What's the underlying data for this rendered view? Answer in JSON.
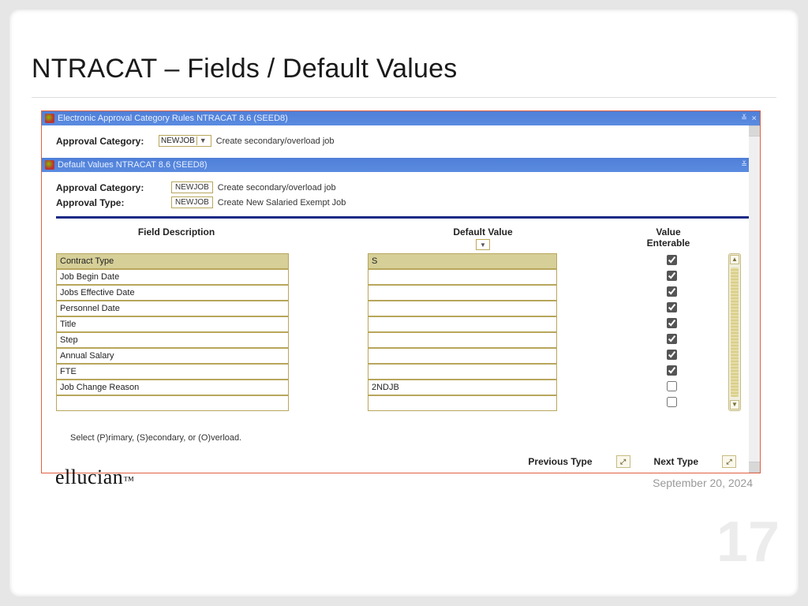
{
  "slide": {
    "title": "NTRACAT – Fields / Default Values",
    "number": "17",
    "date": "September 20, 2024",
    "brand": "ellucian",
    "brand_suffix": "™"
  },
  "window_main": {
    "title": "Electronic Approval Category Rules NTRACAT 8.6 (SEED8)"
  },
  "header": {
    "approval_category_label": "Approval Category:",
    "approval_category_code": "NEWJOB",
    "approval_category_desc": "Create secondary/overload job"
  },
  "window_sub": {
    "title": "Default Values NTRACAT 8.6 (SEED8)"
  },
  "subheader": {
    "approval_category_label": "Approval Category:",
    "approval_category_code": "NEWJOB",
    "approval_category_desc": "Create secondary/overload job",
    "approval_type_label": "Approval Type:",
    "approval_type_code": "NEWJOB",
    "approval_type_desc": "Create New Salaried Exempt Job"
  },
  "columns": {
    "field_description": "Field Description",
    "default_value": "Default Value",
    "value_enterable_1": "Value",
    "value_enterable_2": "Enterable"
  },
  "rows": [
    {
      "field": "Contract Type",
      "default": "S",
      "enterable": true,
      "selected": true
    },
    {
      "field": "Job Begin Date",
      "default": "",
      "enterable": true,
      "selected": false
    },
    {
      "field": "Jobs Effective Date",
      "default": "",
      "enterable": true,
      "selected": false
    },
    {
      "field": "Personnel Date",
      "default": "",
      "enterable": true,
      "selected": false
    },
    {
      "field": "Title",
      "default": "",
      "enterable": true,
      "selected": false
    },
    {
      "field": "Step",
      "default": "",
      "enterable": true,
      "selected": false
    },
    {
      "field": "Annual Salary",
      "default": "",
      "enterable": true,
      "selected": false
    },
    {
      "field": "FTE",
      "default": "",
      "enterable": true,
      "selected": false
    },
    {
      "field": "Job Change Reason",
      "default": "2NDJB",
      "enterable": false,
      "selected": false
    },
    {
      "field": "",
      "default": "",
      "enterable": false,
      "selected": false
    }
  ],
  "hint": "Select (P)rimary, (S)econdary, or (O)verload.",
  "nav": {
    "previous": "Previous Type",
    "next": "Next Type"
  }
}
